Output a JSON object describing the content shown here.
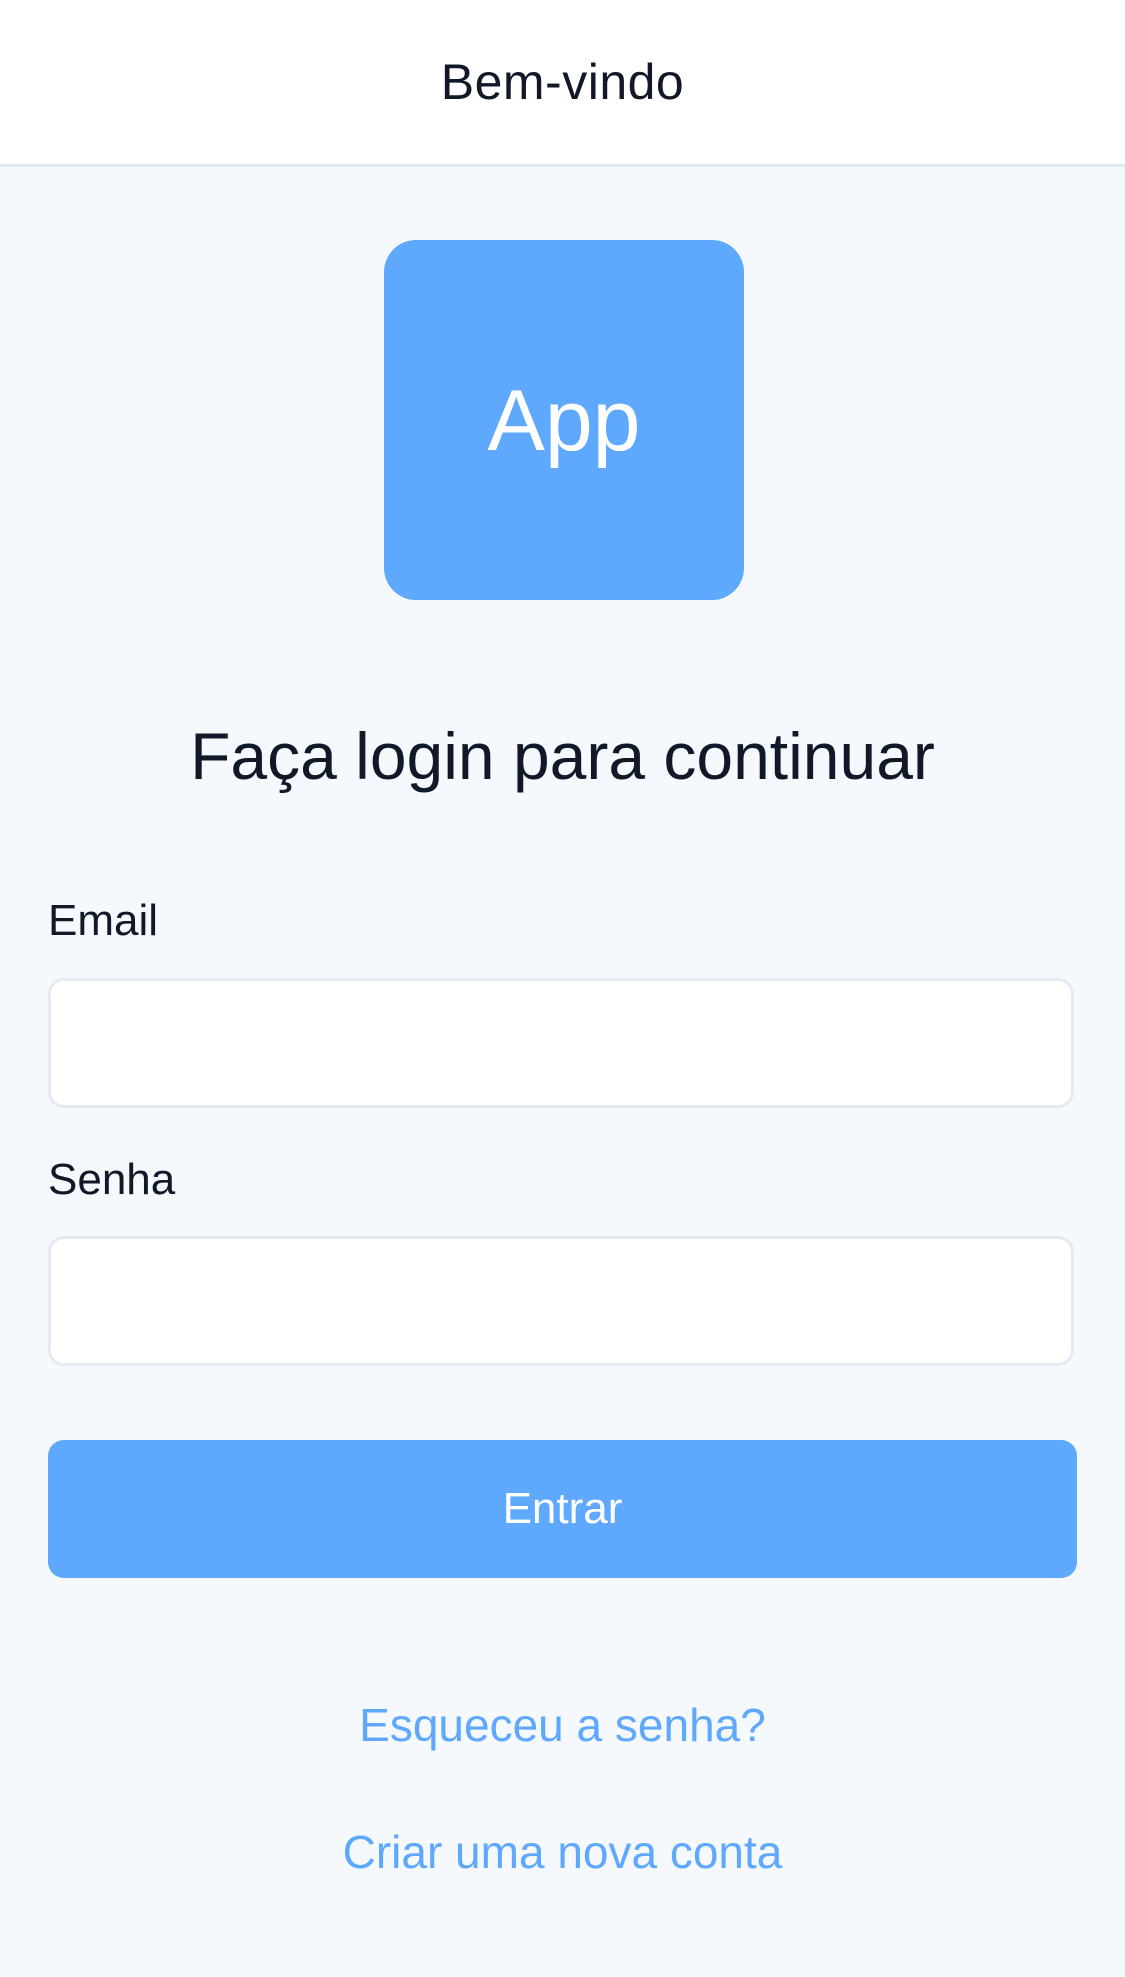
{
  "header": {
    "title": "Bem-vindo"
  },
  "logo": {
    "text": "App",
    "color": "#5ea8fd"
  },
  "main": {
    "heading": "Faça login para continuar"
  },
  "form": {
    "email": {
      "label": "Email",
      "value": "",
      "placeholder": ""
    },
    "password": {
      "label": "Senha",
      "value": "",
      "placeholder": ""
    },
    "submit_label": "Entrar"
  },
  "links": {
    "forgot_password": "Esqueceu a senha?",
    "create_account": "Criar uma nova conta"
  },
  "colors": {
    "accent": "#5ea8fd",
    "background": "#f5f8fc",
    "text": "#111827",
    "border": "#e3eaf2"
  }
}
